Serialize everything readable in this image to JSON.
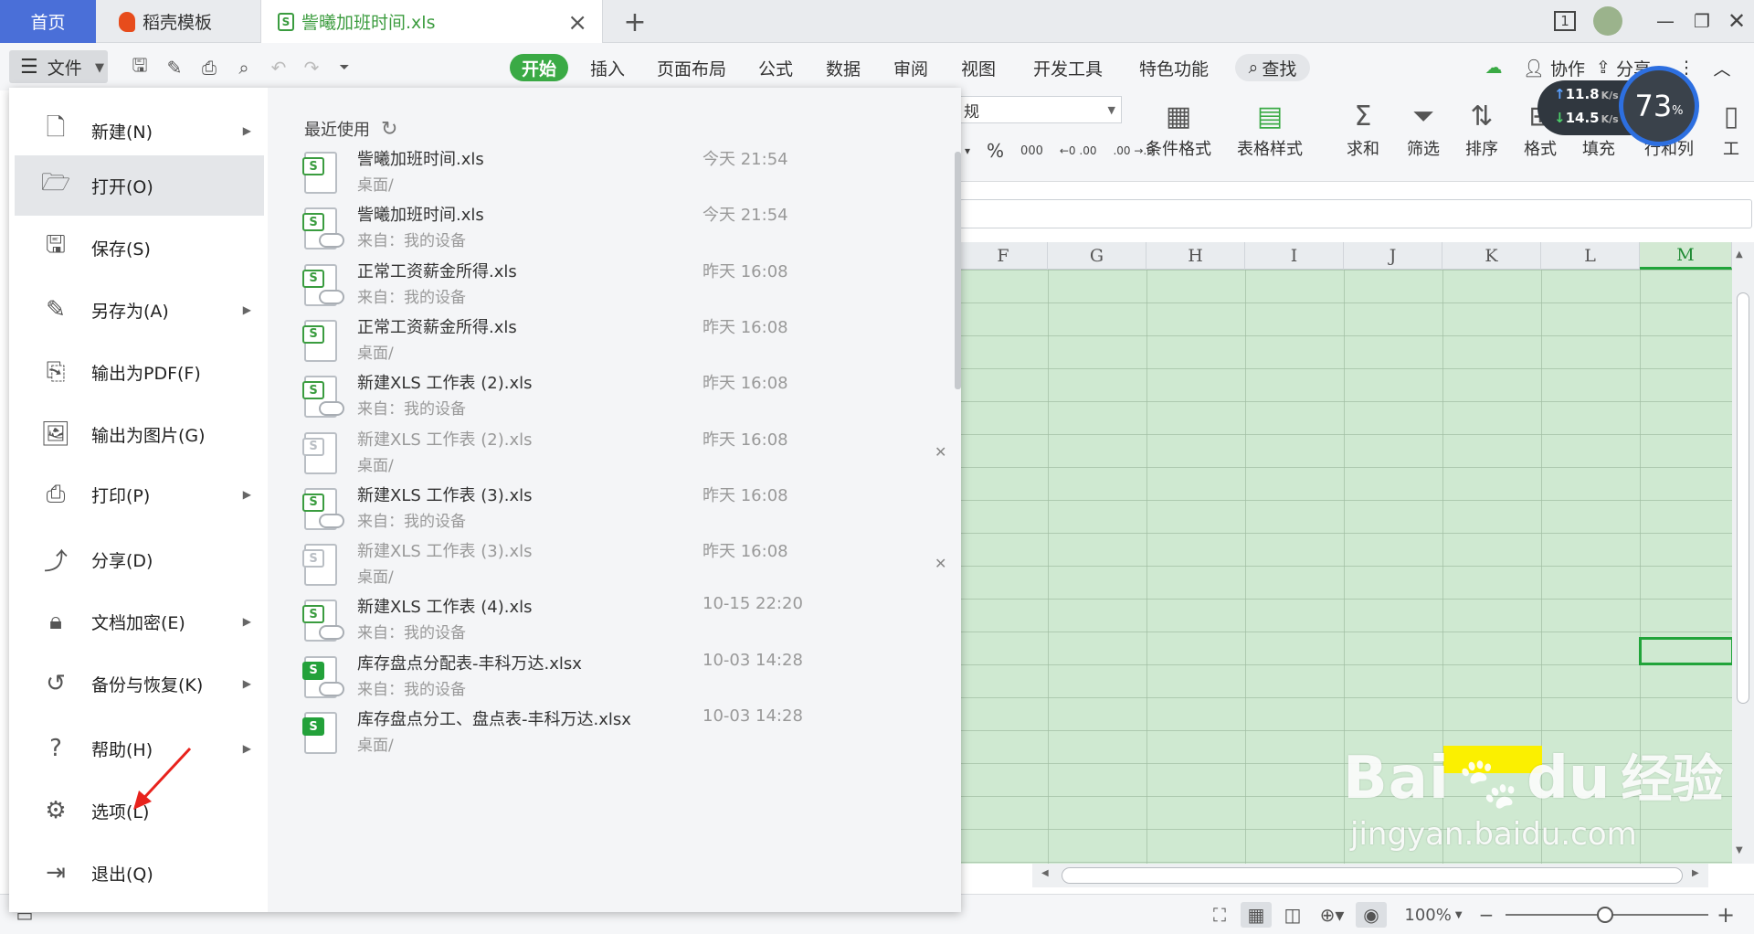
{
  "tabs": {
    "home": "首页",
    "daoke": "稻壳模板",
    "file": "訾曦加班时间.xls",
    "file_icon": "S"
  },
  "window": {
    "page_counter": "1"
  },
  "toolbar": {
    "file_button": "文件",
    "ribbon_tabs": [
      "开始",
      "插入",
      "页面布局",
      "公式",
      "数据",
      "审阅",
      "视图",
      "开发工具",
      "特色功能"
    ],
    "search": "查找",
    "collab": "协作",
    "share": "分享"
  },
  "ribbon": {
    "number_format": "规",
    "percent": "%",
    "thousands": "000",
    "inc_dec": "←0 .00",
    "dec_dec": ".00 →.0",
    "conditional_format": "条件格式",
    "table_style": "表格样式",
    "sum": "求和",
    "filter": "筛选",
    "sort": "排序",
    "format": "格式",
    "fill": "填充",
    "rowcol": "行和列",
    "worksheet": "工"
  },
  "network": {
    "up": "11.8",
    "down": "14.5",
    "unit": "K/s",
    "percent": "73",
    "percent_sign": "%"
  },
  "grid": {
    "columns": [
      "F",
      "G",
      "H",
      "I",
      "J",
      "K",
      "L",
      "M"
    ]
  },
  "file_menu": {
    "items": [
      {
        "label": "新建(N)",
        "icon": "new-doc-icon",
        "arrow": true
      },
      {
        "label": "打开(O)",
        "icon": "folder-open-icon",
        "arrow": false,
        "active": true
      },
      {
        "label": "保存(S)",
        "icon": "save-icon",
        "arrow": false
      },
      {
        "label": "另存为(A)",
        "icon": "save-as-icon",
        "arrow": true
      },
      {
        "label": "输出为PDF(F)",
        "icon": "export-pdf-icon",
        "arrow": false
      },
      {
        "label": "输出为图片(G)",
        "icon": "export-image-icon",
        "arrow": false
      },
      {
        "label": "打印(P)",
        "icon": "printer-icon",
        "arrow": true
      },
      {
        "label": "分享(D)",
        "icon": "share-icon",
        "arrow": false
      },
      {
        "label": "文档加密(E)",
        "icon": "encrypt-icon",
        "arrow": true
      },
      {
        "label": "备份与恢复(K)",
        "icon": "backup-icon",
        "arrow": true
      },
      {
        "label": "帮助(H)",
        "icon": "help-icon",
        "arrow": true
      },
      {
        "label": "选项(L)",
        "icon": "gear-icon",
        "arrow": false
      },
      {
        "label": "退出(Q)",
        "icon": "exit-icon",
        "arrow": false
      }
    ],
    "recent_title": "最近使用",
    "recent": [
      {
        "name": "訾曦加班时间.xls",
        "path": "桌面/",
        "time": "今天 21:54",
        "cloud": false,
        "dim": false,
        "solid": false,
        "close": false
      },
      {
        "name": "訾曦加班时间.xls",
        "path": "来自：我的设备",
        "time": "今天 21:54",
        "cloud": true,
        "dim": false,
        "solid": false,
        "close": false
      },
      {
        "name": "正常工资薪金所得.xls",
        "path": "来自：我的设备",
        "time": "昨天 16:08",
        "cloud": true,
        "dim": false,
        "solid": false,
        "close": false
      },
      {
        "name": "正常工资薪金所得.xls",
        "path": "桌面/",
        "time": "昨天 16:08",
        "cloud": false,
        "dim": false,
        "solid": false,
        "close": false
      },
      {
        "name": "新建XLS 工作表 (2).xls",
        "path": "来自：我的设备",
        "time": "昨天 16:08",
        "cloud": true,
        "dim": false,
        "solid": false,
        "close": false
      },
      {
        "name": "新建XLS 工作表 (2).xls",
        "path": "桌面/",
        "time": "昨天 16:08",
        "cloud": false,
        "dim": true,
        "solid": false,
        "close": true
      },
      {
        "name": "新建XLS 工作表 (3).xls",
        "path": "来自：我的设备",
        "time": "昨天 16:08",
        "cloud": true,
        "dim": false,
        "solid": false,
        "close": false
      },
      {
        "name": "新建XLS 工作表 (3).xls",
        "path": "桌面/",
        "time": "昨天 16:08",
        "cloud": false,
        "dim": true,
        "solid": false,
        "close": true
      },
      {
        "name": "新建XLS 工作表 (4).xls",
        "path": "来自：我的设备",
        "time": "10-15 22:20",
        "cloud": true,
        "dim": false,
        "solid": false,
        "close": false
      },
      {
        "name": "库存盘点分配表-丰科万达.xlsx",
        "path": "来自：我的设备",
        "time": "10-03 14:28",
        "cloud": true,
        "dim": false,
        "solid": true,
        "close": false
      },
      {
        "name": "库存盘点分工、盘点表-丰科万达.xlsx",
        "path": "桌面/",
        "time": "10-03 14:28",
        "cloud": false,
        "dim": false,
        "solid": true,
        "close": false
      }
    ]
  },
  "statusbar": {
    "zoom": "100%"
  },
  "watermark": {
    "brand": "Bai",
    "brand2": "du",
    "sub": "经验",
    "url": "jingyan.baidu.com"
  },
  "colors": {
    "accent_green": "#3aaa45",
    "home_tab": "#4a6fd8",
    "grid_fill": "#cfe9d1"
  }
}
